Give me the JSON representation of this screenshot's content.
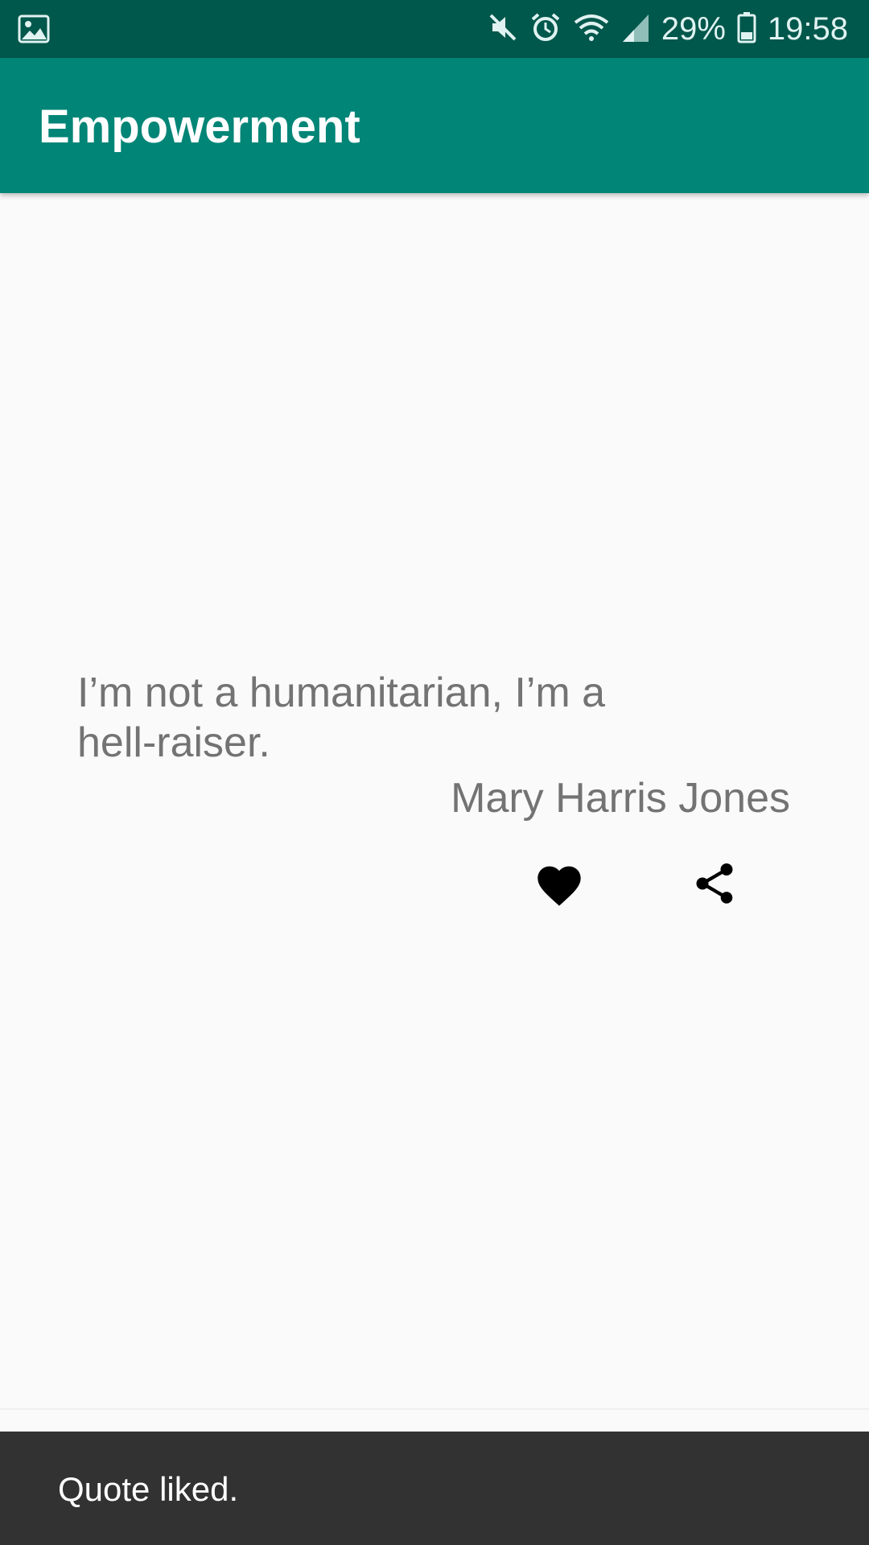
{
  "status_bar": {
    "battery_percent": "29%",
    "time": "19:58",
    "icons": [
      "gallery-icon",
      "mute-icon",
      "alarm-icon",
      "wifi-icon",
      "signal-icon",
      "battery-icon"
    ]
  },
  "app_bar": {
    "title": "Empowerment"
  },
  "quote": {
    "text": "I’m not a humanitarian, I’m a hell-raiser.",
    "author": "Mary Harris Jones",
    "liked": true
  },
  "actions": {
    "like_icon": "heart-icon",
    "share_icon": "share-icon"
  },
  "snackbar": {
    "message": "Quote liked."
  },
  "colors": {
    "status_bar": "#00574b",
    "app_bar": "#008577",
    "background": "#fafafa",
    "quote_text": "#737373",
    "snackbar": "#323232"
  }
}
